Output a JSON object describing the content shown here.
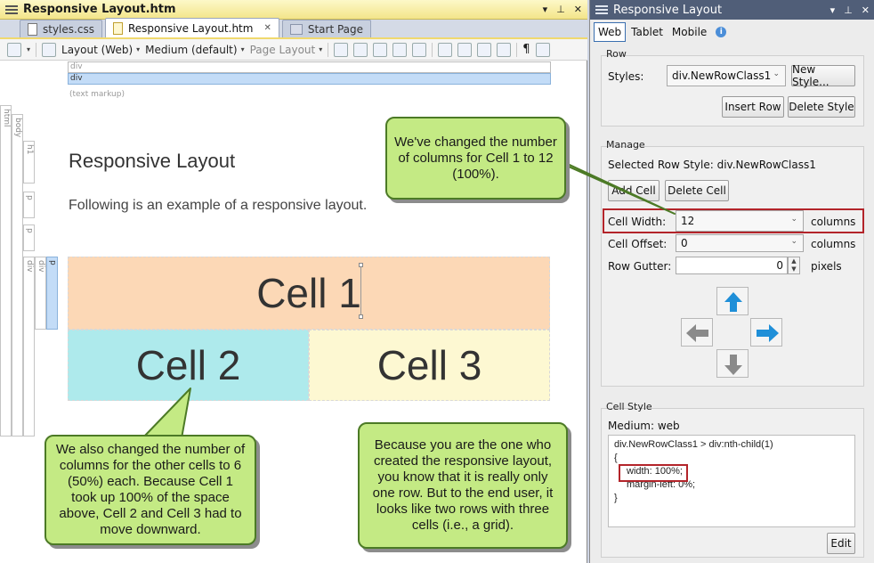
{
  "editor": {
    "title": "Responsive Layout.htm",
    "pane_controls": [
      "▾",
      "⊥",
      "✕"
    ],
    "tabs": [
      {
        "label": "styles.css",
        "icon": "css-file-icon"
      },
      {
        "label": "Responsive Layout.htm",
        "icon": "htm-file-icon",
        "active": true
      },
      {
        "label": "Start Page",
        "icon": "start-page-icon"
      }
    ],
    "toolbar": {
      "layout_dropdown": "Layout (Web)",
      "medium_dropdown": "Medium (default)",
      "page_layout_dropdown": "Page Layout"
    },
    "markup_bars": [
      "div",
      "div"
    ],
    "text_markup_label": "(text markup)",
    "gutter_tags": [
      "html",
      "body",
      "h1",
      "p",
      "p",
      "div",
      "div",
      "p"
    ],
    "heading": "Responsive Layout",
    "paragraph": "Following is an example of a responsive layout.",
    "cells": [
      "Cell 1",
      "Cell 2",
      "Cell 3"
    ]
  },
  "callouts": {
    "one": "We've changed the number of columns for Cell 1 to 12 (100%).",
    "two": "We also changed the number of columns for the other cells to 6 (50%) each. Because Cell 1 took up 100% of the space above, Cell 2 and Cell 3 had to move downward.",
    "three": "Because you are the one who created the responsive layout, you know that it is really only one row. But to the end user, it looks like two rows with three cells (i.e., a grid)."
  },
  "panel": {
    "title": "Responsive Layout",
    "pane_controls": [
      "▾",
      "⊥",
      "✕"
    ],
    "tabs": [
      "Web",
      "Tablet",
      "Mobile"
    ],
    "row": {
      "label": "Row",
      "styles_label": "Styles:",
      "styles_value": "div.NewRowClass1",
      "new_style": "New Style...",
      "insert_row": "Insert Row",
      "delete_style": "Delete Style"
    },
    "manage": {
      "label": "Manage",
      "selected_row_style": "Selected Row Style: div.NewRowClass1",
      "add_cell": "Add Cell",
      "delete_cell": "Delete Cell",
      "cell_width_label": "Cell Width:",
      "cell_width_value": "12",
      "cell_width_unit": "columns",
      "cell_offset_label": "Cell Offset:",
      "cell_offset_value": "0",
      "cell_offset_unit": "columns",
      "row_gutter_label": "Row Gutter:",
      "row_gutter_value": "0",
      "row_gutter_unit": "pixels"
    },
    "cell_style": {
      "label": "Cell Style",
      "medium": "Medium: web",
      "css_lines": [
        "div.NewRowClass1 > div:nth-child(1)",
        "{",
        "width: 100%;",
        "margin-left: 0%;",
        "}"
      ],
      "edit": "Edit"
    }
  },
  "colors": {
    "cell1": "#fcd8b6",
    "cell2": "#aeeaec",
    "cell3": "#fdf8d2",
    "callout_fill": "#c4ea84",
    "callout_border": "#4c7a26",
    "highlight_red": "#b3242a",
    "arrow_blue": "#1f8fd8"
  }
}
